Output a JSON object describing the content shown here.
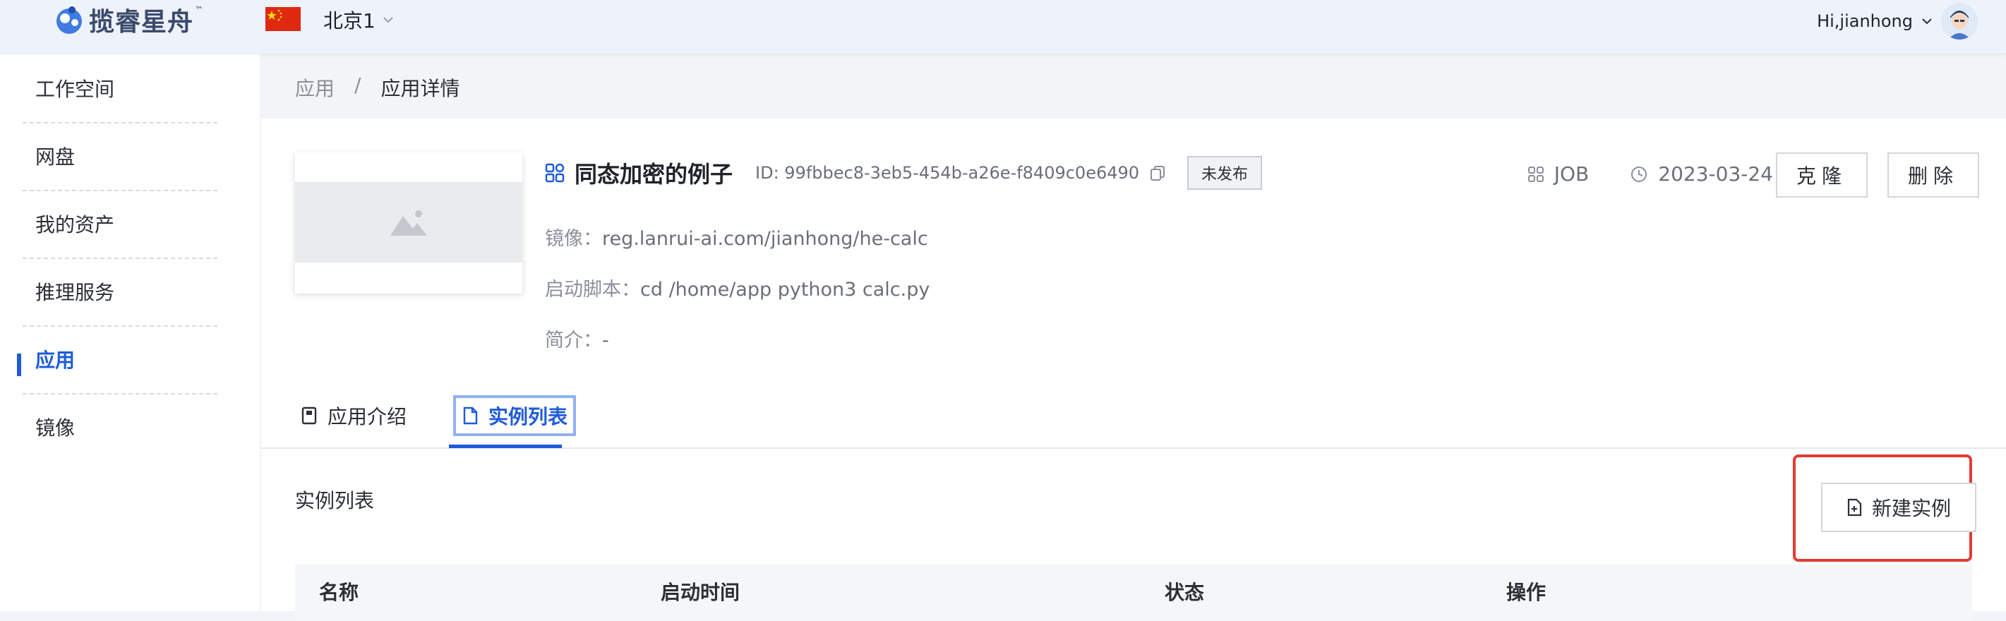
{
  "header": {
    "logo_text": "揽睿星舟",
    "logo_tm": "™",
    "region": "北京1",
    "user_greeting": "Hi,jianhong"
  },
  "sidebar": {
    "items": [
      {
        "label": "工作空间",
        "active": false
      },
      {
        "label": "网盘",
        "active": false
      },
      {
        "label": "我的资产",
        "active": false
      },
      {
        "label": "推理服务",
        "active": false
      },
      {
        "label": "应用",
        "active": true
      },
      {
        "label": "镜像",
        "active": false
      }
    ]
  },
  "breadcrumb": {
    "parent": "应用",
    "separator": "/",
    "current": "应用详情"
  },
  "app": {
    "title": "同态加密的例子",
    "id_text": "ID: 99fbbec8-3eb5-454b-a26e-f8409c0e6490",
    "status_badge": "未发布",
    "type": "JOB",
    "date": "2023-03-24",
    "clone_label": "克隆",
    "delete_label": "删除",
    "image_label": "镜像：",
    "image_value": "reg.lanrui-ai.com/jianhong/he-calc",
    "script_label": "启动脚本：",
    "script_value": "cd /home/app python3 calc.py",
    "intro_label": "简介：",
    "intro_value": "-"
  },
  "tabs": [
    {
      "label": "应用介绍",
      "icon": "document-icon",
      "active": false
    },
    {
      "label": "实例列表",
      "icon": "file-icon",
      "active": true
    }
  ],
  "instances": {
    "section_title": "实例列表",
    "new_button_label": "新建实例",
    "columns": [
      "名称",
      "启动时间",
      "状态",
      "操作"
    ]
  },
  "colors": {
    "accent": "#1e5bd8",
    "highlight": "#e53b30"
  }
}
